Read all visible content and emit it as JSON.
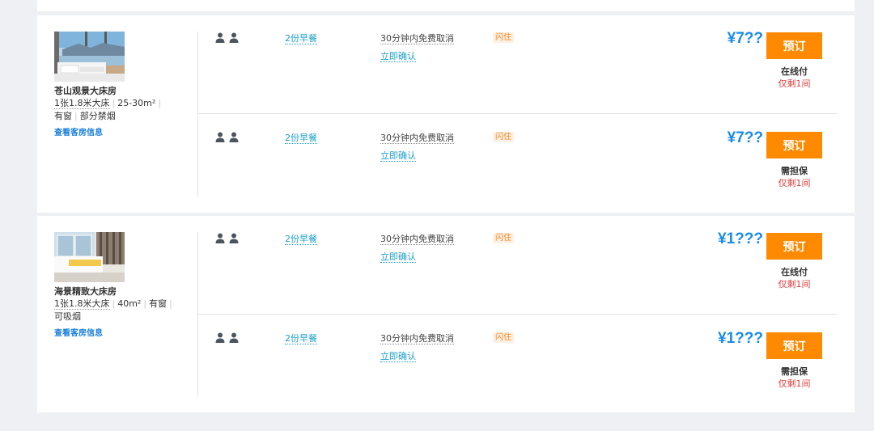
{
  "rooms": [
    {
      "name": "苍山观景大床房",
      "bed": "1张1.8米大床",
      "area": "25-30m²",
      "window": "有窗",
      "smoking": "部分禁烟",
      "info_link": "查看客房信息",
      "rates": [
        {
          "meal": "2份早餐",
          "cancel": "30分钟内免费取消",
          "confirm": "立即确认",
          "badge": "闪住",
          "price": "¥7??",
          "book": "预订",
          "pay": "在线付",
          "stock": "仅剩1间"
        },
        {
          "meal": "2份早餐",
          "cancel": "30分钟内免费取消",
          "confirm": "立即确认",
          "badge": "闪住",
          "price": "¥7??",
          "book": "预订",
          "pay": "需担保",
          "stock": "仅剩1间"
        }
      ]
    },
    {
      "name": "海景精致大床房",
      "bed": "1张1.8米大床",
      "area": "40m²",
      "window": "有窗",
      "smoking": "可吸烟",
      "info_link": "查看客房信息",
      "rates": [
        {
          "meal": "2份早餐",
          "cancel": "30分钟内免费取消",
          "confirm": "立即确认",
          "badge": "闪住",
          "price": "¥1???",
          "book": "预订",
          "pay": "在线付",
          "stock": "仅剩1间"
        },
        {
          "meal": "2份早餐",
          "cancel": "30分钟内免费取消",
          "confirm": "立即确认",
          "badge": "闪住",
          "price": "¥1???",
          "book": "预订",
          "pay": "需担保",
          "stock": "仅剩1间"
        }
      ]
    }
  ],
  "colors": {
    "accent_blue": "#1a8be8",
    "link_cyan": "#1ea0c8",
    "book_orange": "#ff8a00",
    "badge_orange": "#f0871e",
    "stock_red": "#e33c3c"
  },
  "icons": {
    "guest": "person-icon",
    "room_photo": "room-photo"
  }
}
